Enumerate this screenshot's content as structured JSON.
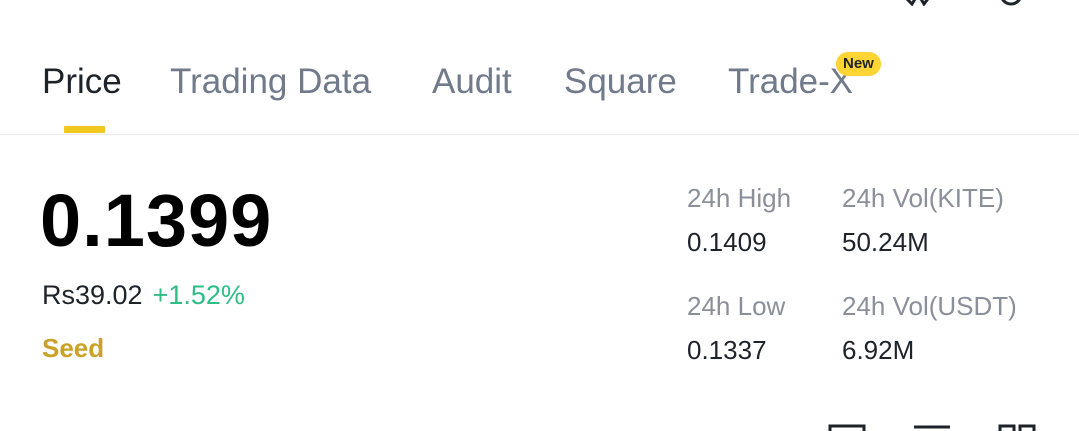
{
  "tabs": [
    {
      "label": "Price",
      "active": true
    },
    {
      "label": "Trading Data",
      "active": false
    },
    {
      "label": "Audit",
      "active": false
    },
    {
      "label": "Square",
      "active": false
    },
    {
      "label": "Trade-X",
      "active": false,
      "badge": "New"
    }
  ],
  "price": {
    "last": "0.1399",
    "fiat": "Rs39.02",
    "change": "+1.52%",
    "tag": "Seed"
  },
  "stats": {
    "high_label": "24h High",
    "high_value": "0.1409",
    "low_label": "24h Low",
    "low_value": "0.1337",
    "vol_base_label": "24h Vol(KITE)",
    "vol_base_value": "50.24M",
    "vol_quote_label": "24h Vol(USDT)",
    "vol_quote_value": "6.92M"
  },
  "colors": {
    "accent": "#fcd535",
    "positive": "#2ebd85",
    "seed": "#c9a227",
    "muted": "#8a8f99"
  },
  "icons": {
    "top": [
      "star-icon",
      "share-icon",
      "more-icon"
    ],
    "bottom": [
      "chart-style-icon",
      "list-icon",
      "grid-icon"
    ]
  }
}
